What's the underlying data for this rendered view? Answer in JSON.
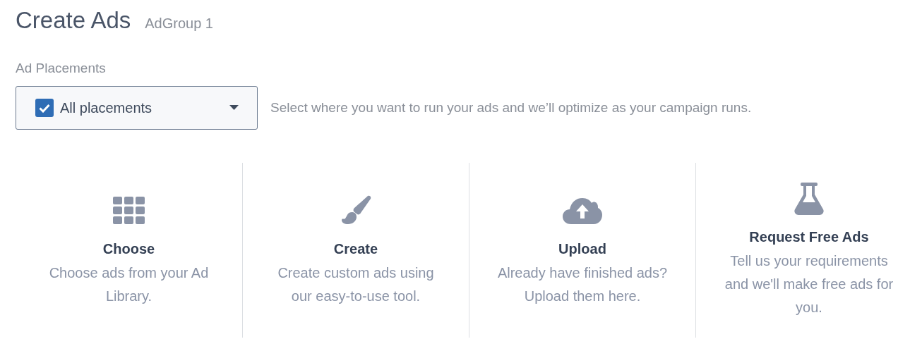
{
  "header": {
    "title": "Create Ads",
    "subtitle": "AdGroup 1"
  },
  "placements": {
    "label": "Ad Placements",
    "value": "All placements",
    "checked": true,
    "hint": "Select where you want to run your ads and we’ll optimize as your campaign runs."
  },
  "options": [
    {
      "title": "Choose",
      "description": "Choose ads from your Ad Library."
    },
    {
      "title": "Create",
      "description": "Create custom ads using our easy-to-use tool."
    },
    {
      "title": "Upload",
      "description": "Already have finished ads? Upload them here."
    },
    {
      "title": "Request Free Ads",
      "description": "Tell us your requirements and we'll make free ads for you."
    }
  ]
}
